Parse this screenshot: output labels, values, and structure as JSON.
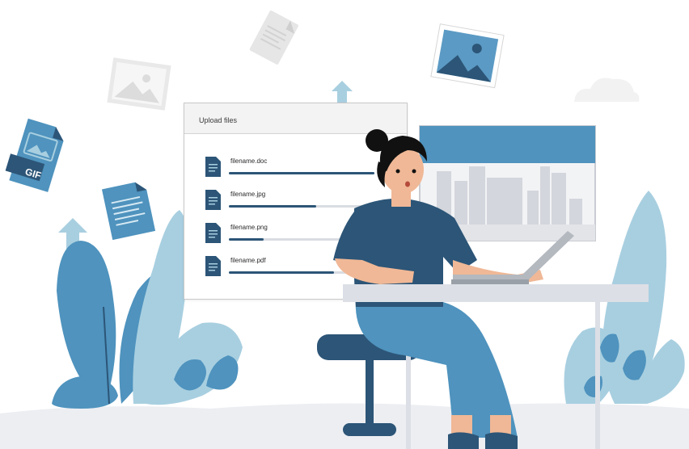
{
  "colors": {
    "primary": "#2c5577",
    "accent": "#4f93be",
    "light_leaf": "#a8cfe0",
    "desk": "#dcdfe6",
    "floor": "#eceef2",
    "skin": "#f0b896"
  },
  "upload_panel": {
    "title": "Upload files",
    "files": [
      {
        "name": "filename.doc",
        "progress": 1.0
      },
      {
        "name": "filename.jpg",
        "progress": 0.6
      },
      {
        "name": "filename.png",
        "progress": 0.24
      },
      {
        "name": "filename.pdf",
        "progress": 0.72
      }
    ]
  },
  "gif_icon": {
    "label": "GIF"
  },
  "icons": [
    "gif-file-icon",
    "document-icon",
    "image-icon",
    "upload-arrow-icon"
  ]
}
